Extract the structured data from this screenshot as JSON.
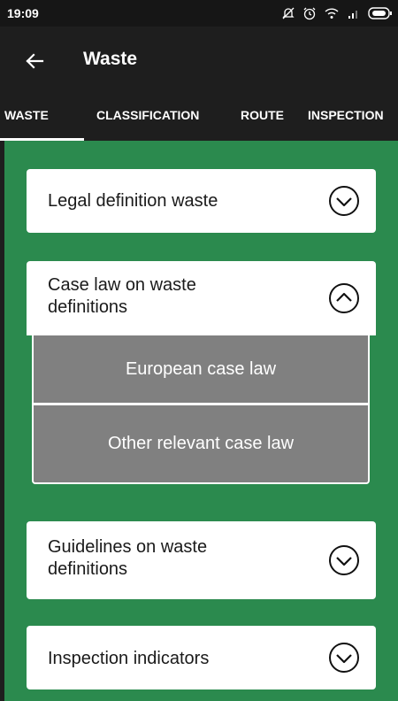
{
  "status_bar": {
    "time": "19:09",
    "icons": [
      "bell-off-icon",
      "alarm-icon",
      "wifi-icon",
      "signal-icon",
      "battery-icon"
    ]
  },
  "app_bar": {
    "title": "Waste",
    "back_icon": "arrow-left-icon"
  },
  "tabs": [
    {
      "label": "WASTE",
      "selected": true
    },
    {
      "label": "CLASSIFICATION",
      "selected": false
    },
    {
      "label": "ROUTE",
      "selected": false
    },
    {
      "label": "INSPECTION",
      "selected": false
    }
  ],
  "accordion": [
    {
      "label": "Legal definition waste",
      "expanded": false,
      "icon": "chevron-down-circle-icon"
    },
    {
      "label": "Case law on waste definitions",
      "expanded": true,
      "icon": "chevron-up-circle-icon",
      "sub_items": [
        {
          "label": "European case law"
        },
        {
          "label": "Other relevant case law"
        }
      ]
    },
    {
      "label": "Guidelines on waste definitions",
      "expanded": false,
      "icon": "chevron-down-circle-icon"
    },
    {
      "label": "Inspection indicators",
      "expanded": false,
      "icon": "chevron-down-circle-icon"
    }
  ],
  "colors": {
    "background_green": "#2b8a4e",
    "app_bar": "#1e1e1e",
    "submenu_gray": "#808080"
  }
}
